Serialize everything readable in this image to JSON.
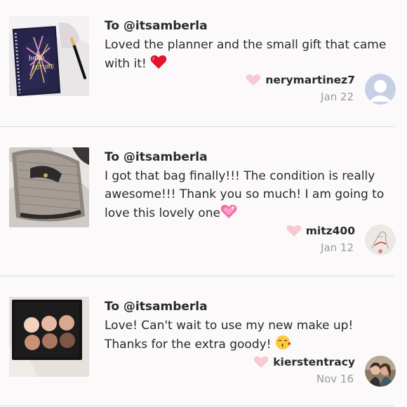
{
  "reviews": [
    {
      "to": "To @itsamberla",
      "text": "Loved the planner and the small gift that came with it! ",
      "emoji": "red-heart",
      "username": "nerymartinez7",
      "date": "Jan 22",
      "thumb": "planner-photo",
      "avatar": "default-avatar"
    },
    {
      "to": "To @itsamberla",
      "text": "I got that bag finally!!! The condition is really awesome!!! Thank you so much! I am going to love this lovely one",
      "emoji": "sparkling-heart",
      "username": "mitz400",
      "date": "Jan 12",
      "thumb": "bag-photo",
      "avatar": "sketch-avatar"
    },
    {
      "to": "To @itsamberla",
      "text": "Love! Can't wait to use my new make up! Thanks for the extra goody! ",
      "emoji": "kissing-face",
      "username": "kierstentracy",
      "date": "Nov 16",
      "thumb": "eyeshadow-palette-photo",
      "avatar": "couple-photo-avatar"
    }
  ],
  "colors": {
    "heart": "#f7c9d3",
    "text": "#2a2a2a",
    "date": "#9a9a9a",
    "divider": "#dcdcdc"
  }
}
